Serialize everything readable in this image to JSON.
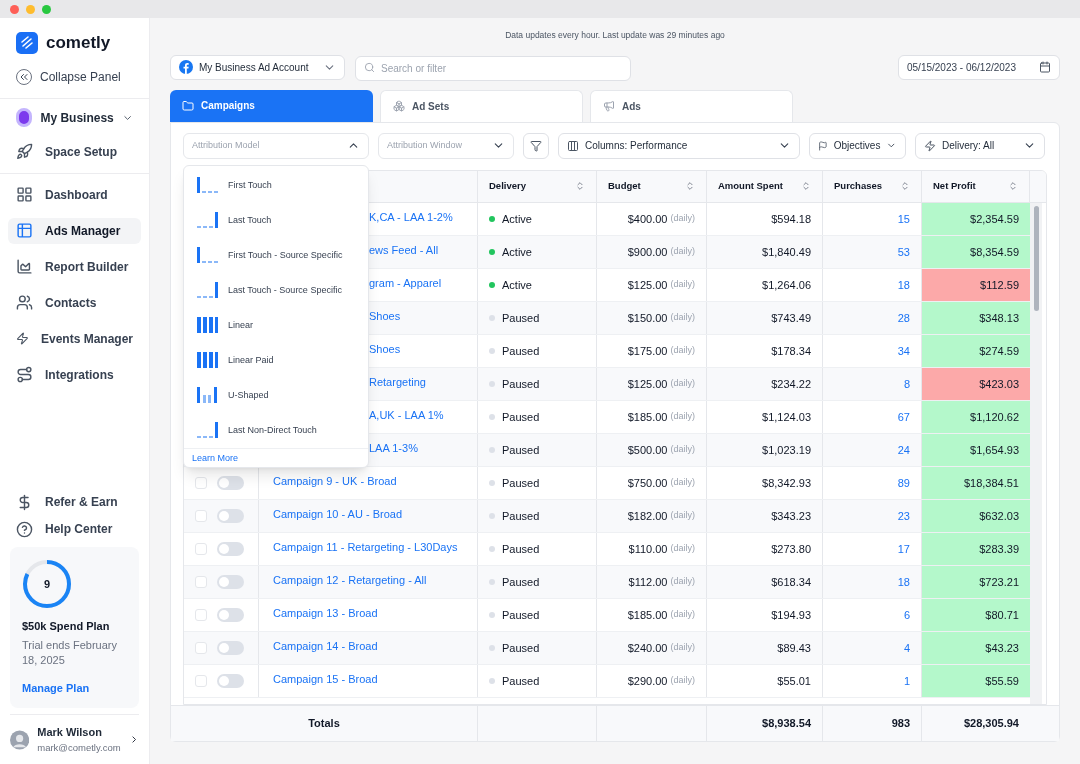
{
  "brand": {
    "name": "cometly"
  },
  "sidebar": {
    "collapse": "Collapse Panel",
    "workspace": "My Business",
    "items": [
      {
        "label": "Space Setup",
        "selected": false
      }
    ],
    "nav": [
      {
        "label": "Dashboard",
        "selected": false
      },
      {
        "label": "Ads Manager",
        "selected": true
      },
      {
        "label": "Report Builder",
        "selected": false
      },
      {
        "label": "Contacts",
        "selected": false
      },
      {
        "label": "Events Manager",
        "selected": false
      },
      {
        "label": "Integrations",
        "selected": false
      }
    ],
    "bottom": [
      {
        "label": "Refer & Earn"
      },
      {
        "label": "Help Center"
      }
    ],
    "plan": {
      "count": "9",
      "level": 0.82,
      "title": "$50k Spend Plan",
      "subtitle": "Trial ends February 18, 2025",
      "link": "Manage Plan"
    },
    "user": {
      "name": "Mark Wilson",
      "email": "mark@cometly.com"
    }
  },
  "notice": "Data updates every hour. Last update was 29 minutes ago",
  "account": "My Business Ad Account",
  "search": {
    "placeholder": "Search or filter"
  },
  "date_range": "05/15/2023 - 06/12/2023",
  "tabs": [
    {
      "label": "Campaigns",
      "selected": true
    },
    {
      "label": "Ad Sets",
      "selected": false
    },
    {
      "label": "Ads",
      "selected": false
    }
  ],
  "filters": {
    "attribution_model": {
      "placeholder": "Attribution Model",
      "expanded": true
    },
    "attribution_window": {
      "placeholder": "Attribution Window"
    },
    "columns": "Columns: Performance",
    "objectives": "Objectives",
    "delivery": "Delivery: All"
  },
  "attribution_menu": {
    "items": [
      {
        "label": "First Touch",
        "kind": "first"
      },
      {
        "label": "Last Touch",
        "kind": "last"
      },
      {
        "label": "First Touch - Source Specific",
        "kind": "first"
      },
      {
        "label": "Last Touch - Source Specific",
        "kind": "last"
      },
      {
        "label": "Linear",
        "kind": "linear"
      },
      {
        "label": "Linear Paid",
        "kind": "linear"
      },
      {
        "label": "U-Shaped",
        "kind": "ushaped"
      },
      {
        "label": "Last Non-Direct Touch",
        "kind": "last"
      }
    ],
    "link": "Learn More"
  },
  "table": {
    "columns": [
      "Delivery",
      "Budget",
      "Amount Spent",
      "Purchases",
      "Net Profit"
    ],
    "rows": [
      {
        "name": "K,CA - LAA 1-2%",
        "covered": true,
        "status": "Active",
        "color": "#22c55e",
        "budget": "$400.00",
        "period": "(daily)",
        "spent": "$594.18",
        "purchases": "15",
        "profit": "$2,354.59",
        "profitable": true
      },
      {
        "name": "ews Feed - All",
        "covered": true,
        "status": "Active",
        "color": "#22c55e",
        "budget": "$900.00",
        "period": "(daily)",
        "spent": "$1,840.49",
        "purchases": "53",
        "profit": "$8,354.59",
        "profitable": true
      },
      {
        "name": "gram - Apparel",
        "covered": true,
        "status": "Active",
        "color": "#22c55e",
        "budget": "$125.00",
        "period": "(daily)",
        "spent": "$1,264.06",
        "purchases": "18",
        "profit": "$112.59",
        "profitable": false
      },
      {
        "name": "Shoes",
        "covered": true,
        "status": "Paused",
        "color": "#dde1e8",
        "budget": "$150.00",
        "period": "(daily)",
        "spent": "$743.49",
        "purchases": "28",
        "profit": "$348.13",
        "profitable": true
      },
      {
        "name": "Shoes",
        "covered": true,
        "status": "Paused",
        "color": "#dde1e8",
        "budget": "$175.00",
        "period": "(daily)",
        "spent": "$178.34",
        "purchases": "34",
        "profit": "$274.59",
        "profitable": true
      },
      {
        "name": "Retargeting",
        "covered": true,
        "status": "Paused",
        "color": "#dde1e8",
        "budget": "$125.00",
        "period": "(daily)",
        "spent": "$234.22",
        "purchases": "8",
        "profit": "$423.03",
        "profitable": false
      },
      {
        "name": "A,UK - LAA 1%",
        "covered": true,
        "status": "Paused",
        "color": "#dde1e8",
        "budget": "$185.00",
        "period": "(daily)",
        "spent": "$1,124.03",
        "purchases": "67",
        "profit": "$1,120.62",
        "profitable": true
      },
      {
        "name": "LAA 1-3%",
        "covered": true,
        "status": "Paused",
        "color": "#dde1e8",
        "budget": "$500.00",
        "period": "(daily)",
        "spent": "$1,023.19",
        "purchases": "24",
        "profit": "$1,654.93",
        "profitable": true
      },
      {
        "name": "Campaign 9 - UK - Broad",
        "covered": false,
        "checked": false,
        "on": false,
        "status": "Paused",
        "color": "#dde1e8",
        "budget": "$750.00",
        "period": "(daily)",
        "spent": "$8,342.93",
        "purchases": "89",
        "profit": "$18,384.51",
        "profitable": true
      },
      {
        "name": "Campaign 10 - AU - Broad",
        "covered": false,
        "checked": false,
        "on": false,
        "status": "Paused",
        "color": "#dde1e8",
        "budget": "$182.00",
        "period": "(daily)",
        "spent": "$343.23",
        "purchases": "23",
        "profit": "$632.03",
        "profitable": true
      },
      {
        "name": "Campaign 11 - Retargeting - L30Days",
        "covered": false,
        "checked": false,
        "on": false,
        "status": "Paused",
        "color": "#dde1e8",
        "budget": "$110.00",
        "period": "(daily)",
        "spent": "$273.80",
        "purchases": "17",
        "profit": "$283.39",
        "profitable": true
      },
      {
        "name": "Campaign 12 - Retargeting - All",
        "covered": false,
        "checked": false,
        "on": false,
        "status": "Paused",
        "color": "#dde1e8",
        "budget": "$112.00",
        "period": "(daily)",
        "spent": "$618.34",
        "purchases": "18",
        "profit": "$723.21",
        "profitable": true
      },
      {
        "name": "Campaign 13 - Broad",
        "covered": false,
        "checked": false,
        "on": false,
        "status": "Paused",
        "color": "#dde1e8",
        "budget": "$185.00",
        "period": "(daily)",
        "spent": "$194.93",
        "purchases": "6",
        "profit": "$80.71",
        "profitable": true
      },
      {
        "name": "Campaign 14 - Broad",
        "covered": false,
        "checked": false,
        "on": false,
        "status": "Paused",
        "color": "#dde1e8",
        "budget": "$240.00",
        "period": "(daily)",
        "spent": "$89.43",
        "purchases": "4",
        "profit": "$43.23",
        "profitable": true
      },
      {
        "name": "Campaign 15 - Broad",
        "covered": false,
        "checked": false,
        "on": false,
        "status": "Paused",
        "color": "#dde1e8",
        "budget": "$290.00",
        "period": "(daily)",
        "spent": "$55.01",
        "purchases": "1",
        "profit": "$55.59",
        "profitable": true
      }
    ],
    "totals": {
      "label": "Totals",
      "spent": "$8,938.54",
      "purchases": "983",
      "profit": "$28,305.94"
    }
  }
}
